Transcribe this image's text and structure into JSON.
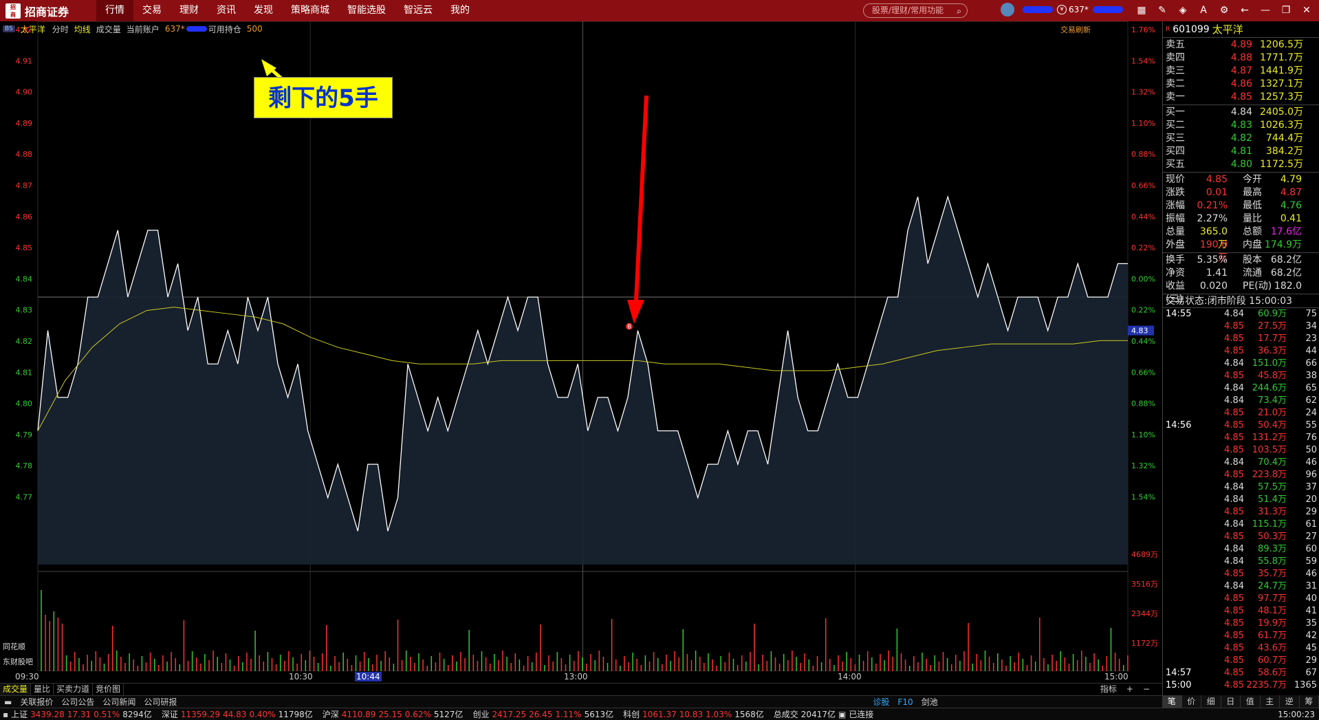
{
  "app": {
    "logo": "招商证券",
    "menu": [
      "行情",
      "交易",
      "理财",
      "资讯",
      "发现",
      "策略商城",
      "智能选股",
      "智远云",
      "我的"
    ],
    "search_placeholder": "股票/理财/常用功能",
    "account": "637*"
  },
  "info": {
    "badge": "BS",
    "stock_name": "太平洋",
    "tab_fenshi": "分时",
    "tab_junxian": "均线",
    "tab_chengjiao": "成交量",
    "account_label": "当前账户",
    "account_no": "637*",
    "available_label": "可用持仓",
    "available": "500",
    "refresh": "交易刷新"
  },
  "annotation": "剩下的5手",
  "marker": "B",
  "price_axis": {
    "left": [
      "4.92",
      "4.91",
      "4.90",
      "4.89",
      "4.88",
      "4.87",
      "4.86",
      "4.85",
      "4.84",
      "4.83",
      "4.82",
      "4.81",
      "4.80",
      "4.79",
      "4.78",
      "4.77"
    ],
    "right": [
      "1.76%",
      "1.54%",
      "1.32%",
      "1.10%",
      "0.88%",
      "0.66%",
      "0.44%",
      "0.22%",
      "0.00%",
      "0.22%",
      "0.44%",
      "0.66%",
      "0.88%",
      "1.10%",
      "1.32%",
      "1.54%"
    ],
    "current_tag": "4.83"
  },
  "volume_axis": [
    "4689万",
    "3516万",
    "2344万",
    "1172万"
  ],
  "side_labels": [
    "同花顺",
    "东财股吧"
  ],
  "time_axis": [
    "09:30",
    "10:30",
    "10:44",
    "13:00",
    "14:00",
    "15:00"
  ],
  "chart_data": {
    "type": "line",
    "series": [
      {
        "values": [
          4.8,
          4.83,
          4.81,
          4.81,
          4.82,
          4.84,
          4.84,
          4.85,
          4.86,
          4.84,
          4.85,
          4.86,
          4.86,
          4.84,
          4.85,
          4.83,
          4.84,
          4.82,
          4.82,
          4.83,
          4.82,
          4.84,
          4.83,
          4.84,
          4.82,
          4.81,
          4.82,
          4.8,
          4.79,
          4.78,
          4.79,
          4.78,
          4.77,
          4.79,
          4.79,
          4.77,
          4.78,
          4.82,
          4.81,
          4.8,
          4.81,
          4.8,
          4.81,
          4.82,
          4.83,
          4.82,
          4.83,
          4.84,
          4.83,
          4.84,
          4.84,
          4.82,
          4.81,
          4.81,
          4.82,
          4.8,
          4.81,
          4.81,
          4.8,
          4.81,
          4.83,
          4.82,
          4.8,
          4.8,
          4.8,
          4.79,
          4.78,
          4.79,
          4.79,
          4.8,
          4.79,
          4.8,
          4.8,
          4.79,
          4.81,
          4.83,
          4.81,
          4.8,
          4.8,
          4.81,
          4.82,
          4.81,
          4.81,
          4.82,
          4.83,
          4.84,
          4.84,
          4.86,
          4.87,
          4.85,
          4.86,
          4.87,
          4.86,
          4.85,
          4.84,
          4.85,
          4.84,
          4.83,
          4.84,
          4.84,
          4.84,
          4.83,
          4.84,
          4.84,
          4.85,
          4.84,
          4.84,
          4.84,
          4.85,
          4.85
        ]
      },
      {
        "values": [
          4.8,
          4.815,
          4.825,
          4.832,
          4.836,
          4.837,
          4.836,
          4.835,
          4.834,
          4.832,
          4.828,
          4.825,
          4.823,
          4.821,
          4.82,
          4.82,
          4.82,
          4.821,
          4.821,
          4.821,
          4.821,
          4.821,
          4.821,
          4.82,
          4.82,
          4.82,
          4.819,
          4.818,
          4.818,
          4.818,
          4.819,
          4.82,
          4.822,
          4.824,
          4.825,
          4.826,
          4.826,
          4.826,
          4.826,
          4.827,
          4.827
        ]
      }
    ],
    "ylim": [
      4.76,
      4.92
    ]
  },
  "quotes": {
    "code": "601099",
    "name": "太平洋",
    "sell": [
      {
        "label": "卖五",
        "price": "4.89",
        "vol": "1206.5万"
      },
      {
        "label": "卖四",
        "price": "4.88",
        "vol": "1771.7万"
      },
      {
        "label": "卖三",
        "price": "4.87",
        "vol": "1441.9万"
      },
      {
        "label": "卖二",
        "price": "4.86",
        "vol": "1327.1万"
      },
      {
        "label": "卖一",
        "price": "4.85",
        "vol": "1257.3万"
      }
    ],
    "buy": [
      {
        "label": "买一",
        "price": "4.84",
        "vol": "2405.0万"
      },
      {
        "label": "买二",
        "price": "4.83",
        "vol": "1026.3万"
      },
      {
        "label": "买三",
        "price": "4.82",
        "vol": "744.4万"
      },
      {
        "label": "买四",
        "price": "4.81",
        "vol": "384.2万"
      },
      {
        "label": "买五",
        "price": "4.80",
        "vol": "1172.5万"
      }
    ],
    "stats": [
      [
        "现价",
        "4.85",
        "今开",
        "4.79"
      ],
      [
        "涨跌",
        "0.01",
        "最高",
        "4.87"
      ],
      [
        "涨幅",
        "0.21%",
        "最低",
        "4.76"
      ],
      [
        "振幅",
        "2.27%",
        "量比",
        "0.41"
      ],
      [
        "总量",
        "365.0万",
        "总额",
        "17.6亿"
      ],
      [
        "外盘",
        "190.0万",
        "内盘",
        "174.9万"
      ]
    ],
    "stats2": [
      [
        "换手",
        "5.35%",
        "股本",
        "68.2亿"
      ],
      [
        "净资",
        "1.41",
        "流通",
        "68.2亿"
      ],
      [
        "收益(三)",
        "0.020",
        "PE(动)",
        "182.0"
      ]
    ],
    "trade_status": "交易状态:闭市阶段 15:00:03",
    "ticks": [
      [
        "14:55",
        "4.84",
        "60.9万",
        "75"
      ],
      [
        "",
        "4.85",
        "27.5万",
        "34"
      ],
      [
        "",
        "4.85",
        "17.7万",
        "23"
      ],
      [
        "",
        "4.85",
        "36.3万",
        "44"
      ],
      [
        "",
        "4.84",
        "151.0万",
        "66"
      ],
      [
        "",
        "4.85",
        "45.8万",
        "38"
      ],
      [
        "",
        "4.84",
        "244.6万",
        "65"
      ],
      [
        "",
        "4.84",
        "73.4万",
        "62"
      ],
      [
        "",
        "4.85",
        "21.0万",
        "24"
      ],
      [
        "14:56",
        "4.85",
        "50.4万",
        "55"
      ],
      [
        "",
        "4.85",
        "131.2万",
        "76"
      ],
      [
        "",
        "4.85",
        "103.5万",
        "50"
      ],
      [
        "",
        "4.84",
        "70.4万",
        "46"
      ],
      [
        "",
        "4.85",
        "223.8万",
        "96"
      ],
      [
        "",
        "4.84",
        "57.5万",
        "37"
      ],
      [
        "",
        "4.84",
        "51.4万",
        "20"
      ],
      [
        "",
        "4.85",
        "31.3万",
        "29"
      ],
      [
        "",
        "4.84",
        "115.1万",
        "61"
      ],
      [
        "",
        "4.85",
        "50.3万",
        "27"
      ],
      [
        "",
        "4.84",
        "89.3万",
        "60"
      ],
      [
        "",
        "4.84",
        "55.8万",
        "59"
      ],
      [
        "",
        "4.85",
        "35.7万",
        "46"
      ],
      [
        "",
        "4.84",
        "24.7万",
        "31"
      ],
      [
        "",
        "4.85",
        "97.7万",
        "40"
      ],
      [
        "",
        "4.85",
        "48.1万",
        "41"
      ],
      [
        "",
        "4.85",
        "19.9万",
        "35"
      ],
      [
        "",
        "4.85",
        "61.7万",
        "42"
      ],
      [
        "",
        "4.85",
        "43.6万",
        "45"
      ],
      [
        "",
        "4.85",
        "60.7万",
        "29"
      ],
      [
        "14:57",
        "4.85",
        "58.6万",
        "67"
      ],
      [
        "15:00",
        "4.85",
        "2235.7万",
        "1365"
      ]
    ],
    "tabs": [
      "笔",
      "价",
      "细",
      "日",
      "值",
      "主",
      "逆",
      "筹"
    ]
  },
  "bottom_tabs1": [
    "成交量",
    "量比",
    "买卖力道",
    "竞价图"
  ],
  "bottom_tabs1_right": [
    "指标",
    "+",
    "−"
  ],
  "bottom_tabs2": [
    "关联报价",
    "公司公告",
    "公司新闻",
    "公司研报"
  ],
  "bottom_tabs2_right": [
    "诊股",
    "F10",
    "剑池"
  ],
  "status": {
    "sh": [
      "上证",
      "3439.28",
      "17.31",
      "0.51%",
      "8294亿"
    ],
    "sz": [
      "深证",
      "11359.29",
      "44.83",
      "0.40%",
      "11798亿"
    ],
    "hs": [
      "沪深",
      "4110.89",
      "25.15",
      "0.62%",
      "5127亿"
    ],
    "cy": [
      "创业",
      "2417.25",
      "26.45",
      "1.11%",
      "5613亿"
    ],
    "kc": [
      "科创",
      "1061.37",
      "10.83",
      "1.03%",
      "1568亿"
    ],
    "total_label": "总成交",
    "total": "20417亿",
    "conn": "已连接",
    "time": "15:00:23"
  }
}
